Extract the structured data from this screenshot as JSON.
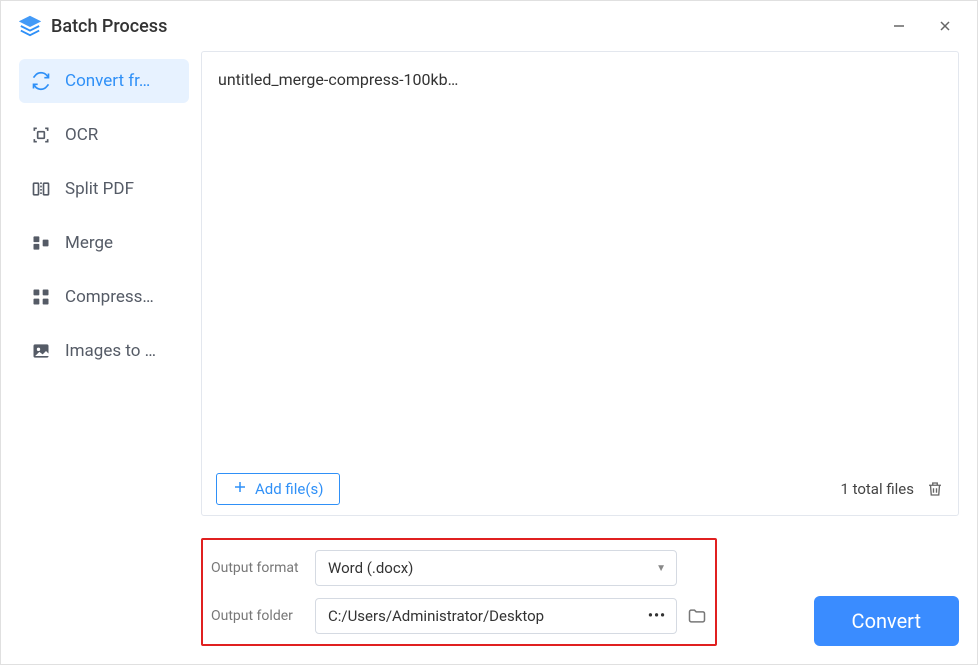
{
  "window": {
    "title": "Batch Process"
  },
  "sidebar": {
    "items": [
      {
        "label": "Convert fr…"
      },
      {
        "label": "OCR"
      },
      {
        "label": "Split PDF"
      },
      {
        "label": "Merge"
      },
      {
        "label": "Compress…"
      },
      {
        "label": "Images to …"
      }
    ]
  },
  "files": {
    "entries": [
      "untitled_merge-compress-100kb…"
    ],
    "add_label": "Add file(s)",
    "total_label": "1 total files"
  },
  "options": {
    "format_label": "Output format",
    "format_value": "Word (.docx)",
    "folder_label": "Output folder",
    "folder_value": "C:/Users/Administrator/Desktop"
  },
  "actions": {
    "convert": "Convert"
  }
}
